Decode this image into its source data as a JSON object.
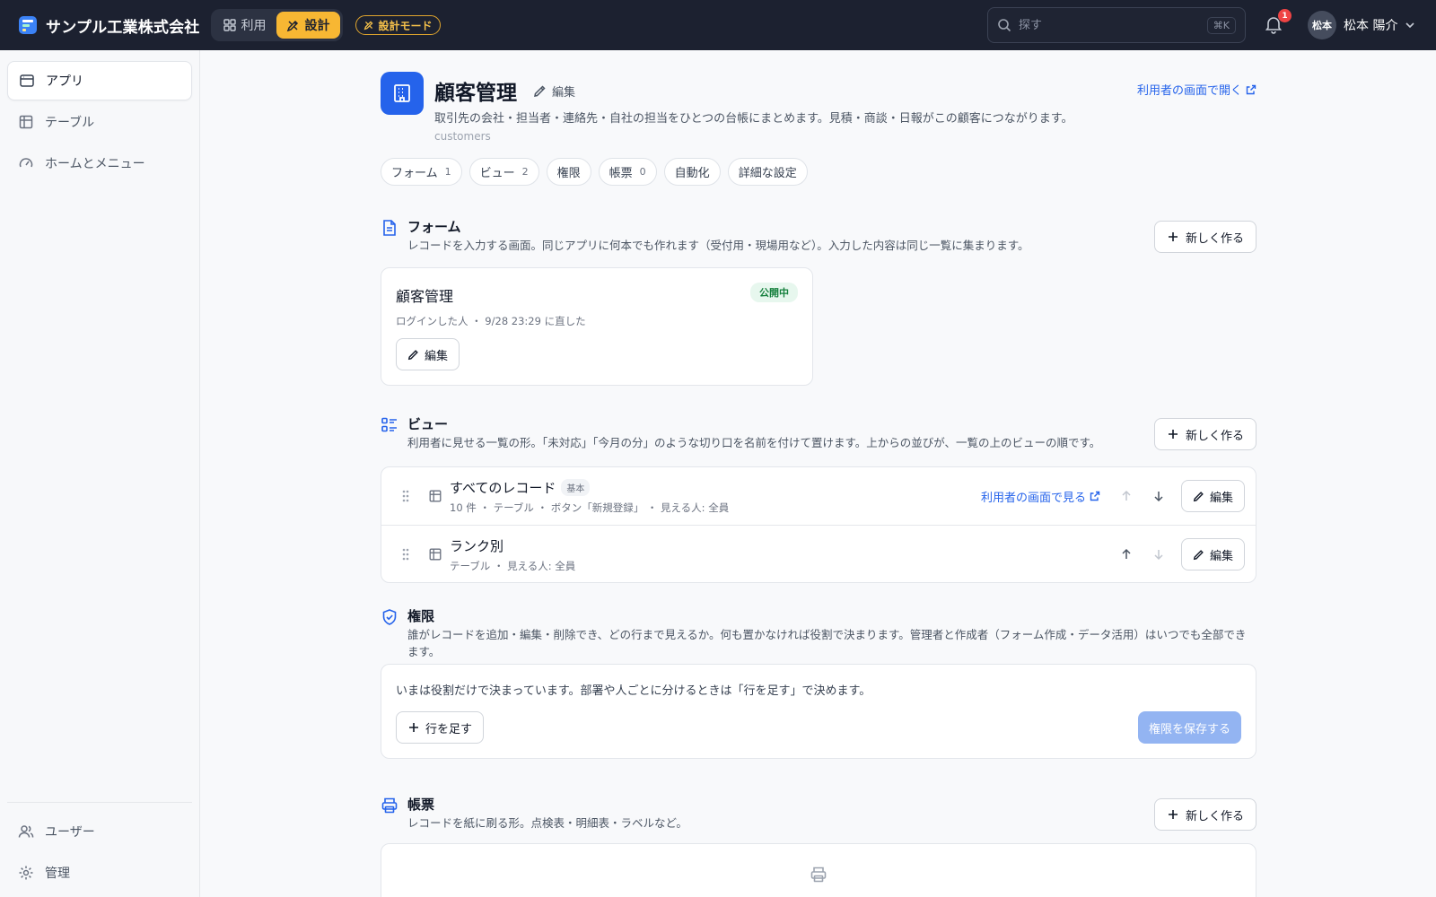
{
  "colors": {
    "topbar": "#1c2130",
    "accent": "#2563eb",
    "design_mode": "#f7b733",
    "published": "#15803d",
    "notification": "#ef4444"
  },
  "header": {
    "company": "サンプル工業株式会社",
    "mode_use": "利用",
    "mode_design": "設計",
    "design_mode_badge": "設計モード",
    "search_placeholder": "探す",
    "search_shortcut": "⌘K",
    "notification_count": "1",
    "avatar_initials": "松本",
    "user_name": "松本 陽介"
  },
  "sidebar": {
    "items": [
      {
        "label": "アプリ",
        "icon": "app-window-icon"
      },
      {
        "label": "テーブル",
        "icon": "table-icon"
      },
      {
        "label": "ホームとメニュー",
        "icon": "gauge-icon"
      }
    ],
    "bottom_items": [
      {
        "label": "ユーザー",
        "icon": "users-icon"
      },
      {
        "label": "管理",
        "icon": "gear-icon"
      }
    ]
  },
  "app": {
    "title": "顧客管理",
    "edit_label": "編集",
    "description": "取引先の会社・担当者・連絡先・自社の担当をひとつの台帳にまとめます。見積・商談・日報がこの顧客につながります。",
    "key": "customers",
    "open_user_view": "利用者の画面で開く"
  },
  "tabs": [
    {
      "label": "フォーム",
      "count": "1"
    },
    {
      "label": "ビュー",
      "count": "2"
    },
    {
      "label": "権限",
      "count": ""
    },
    {
      "label": "帳票",
      "count": "0"
    },
    {
      "label": "自動化",
      "count": ""
    },
    {
      "label": "詳細な設定",
      "count": ""
    }
  ],
  "forms_section": {
    "title": "フォーム",
    "description": "レコードを入力する画面。同じアプリに何本でも作れます（受付用・現場用など）。入力した内容は同じ一覧に集まります。",
    "new_label": "新しく作る",
    "card": {
      "title": "顧客管理",
      "status": "公開中",
      "meta": "ログインした人 ・ 9/28 23:29 に直した",
      "edit_label": "編集"
    }
  },
  "views_section": {
    "title": "ビュー",
    "description": "利用者に見せる一覧の形。「未対応」「今月の分」のような切り口を名前を付けて置けます。上からの並びが、一覧の上のビューの順です。",
    "new_label": "新しく作る",
    "rows": [
      {
        "name": "すべてのレコード",
        "tag": "基本",
        "meta": "10 件 ・ テーブル ・ ボタン「新規登録」 ・ 見える人: 全員",
        "link": "利用者の画面で見る",
        "edit_label": "編集"
      },
      {
        "name": "ランク別",
        "tag": "",
        "meta": "テーブル ・ 見える人: 全員",
        "link": "",
        "edit_label": "編集"
      }
    ]
  },
  "permissions_section": {
    "title": "権限",
    "description": "誰がレコードを追加・編集・削除でき、どの行まで見えるか。何も置かなければ役割で決まります。管理者と作成者（フォーム作成・データ活用）はいつでも全部できます。",
    "note": "いまは役割だけで決まっています。部署や人ごとに分けるときは「行を足す」で決めます。",
    "add_row_label": "行を足す",
    "save_label": "権限を保存する"
  },
  "reports_section": {
    "title": "帳票",
    "description": "レコードを紙に刷る形。点検表・明細表・ラベルなど。",
    "new_label": "新しく作る"
  }
}
